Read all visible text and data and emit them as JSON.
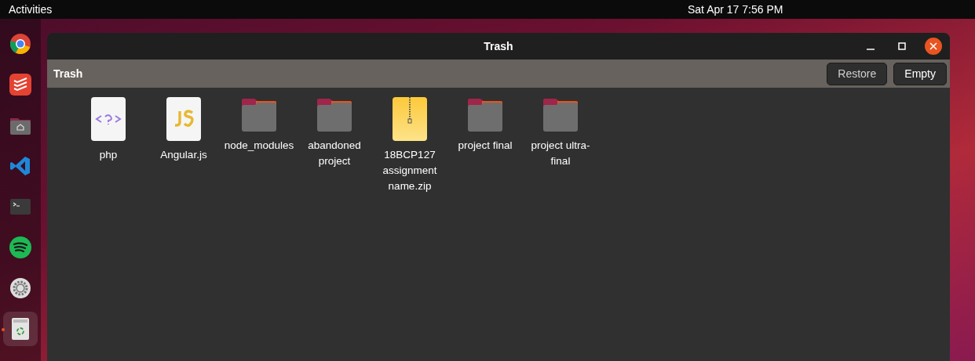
{
  "top_bar": {
    "activities": "Activities",
    "clock": "Sat Apr 17  7:56 PM"
  },
  "dock": [
    {
      "kind": "chrome",
      "running": false
    },
    {
      "kind": "todo",
      "running": false
    },
    {
      "kind": "files",
      "running": false
    },
    {
      "kind": "code",
      "running": false
    },
    {
      "kind": "terminal",
      "running": false
    },
    {
      "kind": "spotify",
      "running": false
    },
    {
      "kind": "settings",
      "running": false
    },
    {
      "kind": "trash",
      "running": true
    }
  ],
  "window": {
    "title": "Trash",
    "location": "Trash",
    "buttons": [
      "Restore",
      "Empty"
    ]
  },
  "files": [
    {
      "name": "php",
      "kind": "php"
    },
    {
      "name": "Angular.js",
      "kind": "js"
    },
    {
      "name": "node_modules",
      "kind": "folder"
    },
    {
      "name": "abandoned project",
      "kind": "folder"
    },
    {
      "name": "18BCP127 assignment name.zip",
      "kind": "zip"
    },
    {
      "name": "project final",
      "kind": "folder"
    },
    {
      "name": "project ultra-final",
      "kind": "folder"
    }
  ]
}
